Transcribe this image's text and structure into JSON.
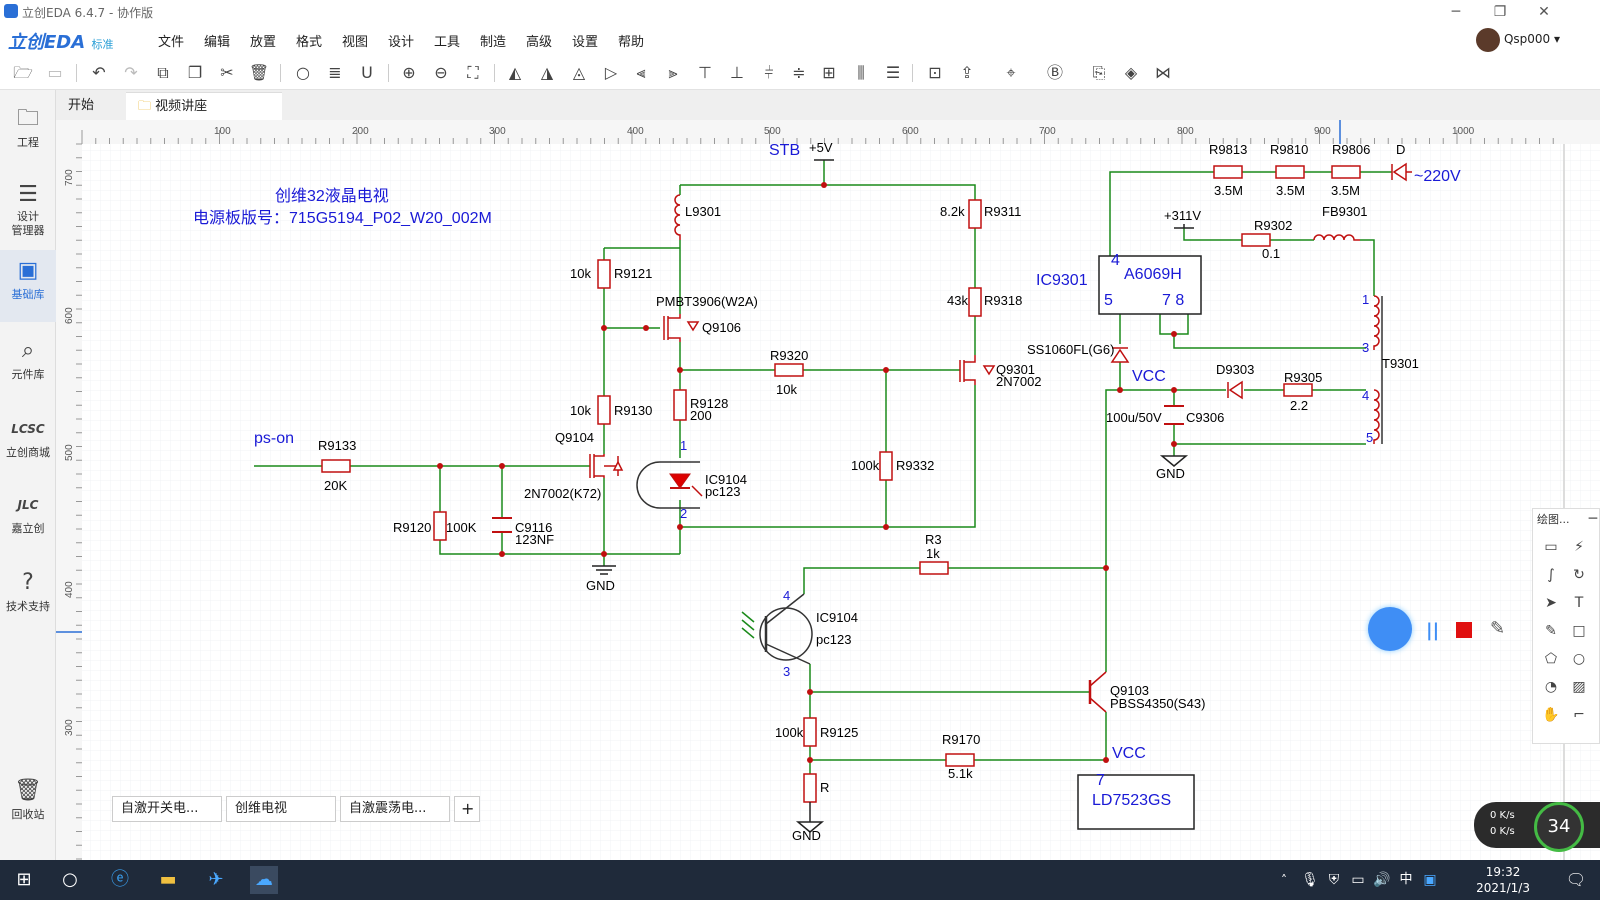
{
  "window": {
    "title": "立创EDA 6.4.7 - 协作版"
  },
  "app": {
    "logo": "立创EDA",
    "logo_sub": "标准",
    "user": "Qsp000 ▾"
  },
  "menu": [
    "文件",
    "编辑",
    "放置",
    "格式",
    "视图",
    "设计",
    "工具",
    "制造",
    "高级",
    "设置",
    "帮助"
  ],
  "sidebar": [
    {
      "label": "工程",
      "icon": "folder-icon"
    },
    {
      "label": "设计\n管理器",
      "icon": "list-icon"
    },
    {
      "label": "基础库",
      "icon": "chip-icon"
    },
    {
      "label": "元件库",
      "icon": "search-icon"
    },
    {
      "label": "立创商城",
      "icon": "lcsc-icon"
    },
    {
      "label": "嘉立创",
      "icon": "jlc-icon"
    },
    {
      "label": "技术支持",
      "icon": "help-icon"
    },
    {
      "label": "回收站",
      "icon": "trash-icon"
    }
  ],
  "tabs": {
    "start": "开始",
    "doc": "视频讲座"
  },
  "ruler": [
    "100",
    "200",
    "300",
    "400",
    "500",
    "600",
    "700",
    "800",
    "900",
    "1000"
  ],
  "ruler_v": [
    "700",
    "600",
    "500",
    "400",
    "300"
  ],
  "bottom_tabs": [
    "自激开关电...",
    "创维电视",
    "自激震荡电..."
  ],
  "add_tab": "+",
  "draw_panel": {
    "title": "绘图..."
  },
  "speed": {
    "up": "0 K/s",
    "down": "0 K/s",
    "pct": "34"
  },
  "clock": {
    "time": "19:32",
    "date": "2021/1/3"
  },
  "taskbar_ime": "中",
  "schematic": {
    "title1": "创维32液晶电视",
    "title2": "电源板版号：715G5194_P02_W20_002M",
    "labels": {
      "stb": "STB",
      "p5v": "+5V",
      "pson": "ps-on",
      "gnd": "GND",
      "vcc": "VCC",
      "p311": "+311V",
      "ac": "~220V",
      "L9301": "L9301",
      "R9121": "R9121",
      "r9121v": "10k",
      "pmbt": "PMBT3906(W2A)",
      "Q9106": "Q9106",
      "R9311": "R9311",
      "r9311v": "8.2k",
      "R9318": "R9318",
      "r9318v": "43k",
      "Q9301": "Q9301",
      "q9301t": "2N7002",
      "R9320": "R9320",
      "r9320v": "10k",
      "R9128": "R9128",
      "r9128v": "200",
      "R9130": "R9130",
      "r9130v": "10k",
      "Q9104": "Q9104",
      "q9104t": "2N7002(K72)",
      "R9133": "R9133",
      "r9133v": "20K",
      "R9120": "R9120",
      "r9120v": "100K",
      "C9116": "C9116",
      "c9116v": "123NF",
      "IC9104": "IC9104",
      "pc123": "pc123",
      "R9332": "R9332",
      "r9332v": "100k",
      "R3": "R3",
      "r3v": "1k",
      "IC9104b": "IC9104",
      "pc123b": "pc123",
      "Q9103": "Q9103",
      "q9103t": "PBSS4350(S43)",
      "R9125": "R9125",
      "r9125v": "100k",
      "R9170": "R9170",
      "r9170v": "5.1k",
      "R": "R",
      "LD": "LD7523GS",
      "ld7": "7",
      "R9813": "R9813",
      "R9810": "R9810",
      "R9806": "R9806",
      "D": "D",
      "r35a": "3.5M",
      "r35b": "3.5M",
      "r35c": "3.5M",
      "R9302": "R9302",
      "r9302v": "0.1",
      "FB9301": "FB9301",
      "IC9301": "IC9301",
      "A6069H": "A6069H",
      "p4": "4",
      "p5": "5",
      "p78": "7  8",
      "SS1060": "SS1060FL(G6)",
      "D9303": "D9303",
      "R9305": "R9305",
      "r9305v": "2.2",
      "C9306": "C9306",
      "c9306v": "100u/50V",
      "T9301": "T9301",
      "t1": "1",
      "t3": "3",
      "t4": "4",
      "t5": "5",
      "pin1": "1",
      "pin2": "2",
      "pin4": "4",
      "pin3": "3"
    }
  }
}
